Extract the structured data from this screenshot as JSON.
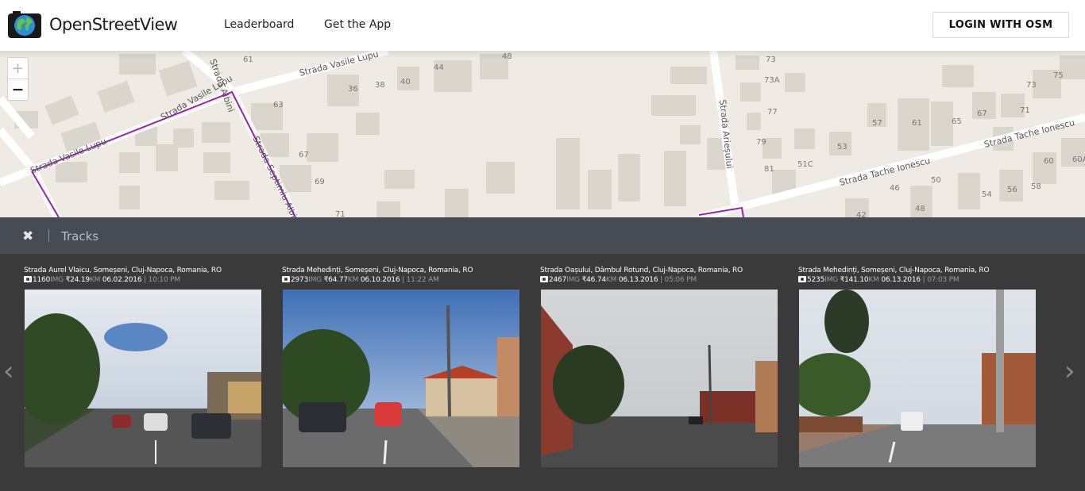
{
  "header": {
    "logo_text": "OpenStreetView",
    "nav": [
      "Leaderboard",
      "Get the App"
    ],
    "login_label": "LOGIN WITH OSM"
  },
  "map": {
    "zoom_in": "+",
    "zoom_out": "−",
    "street_labels": [
      "Strada Vasile Lupu",
      "Strada Vasile Lupu",
      "Strada Albini",
      "Strada Septimiu Albini",
      "Strada Arieșului",
      "Strada Tache Ionescu",
      "Strada Tache Ionescu"
    ],
    "house_numbers": [
      "61",
      "48",
      "44",
      "40",
      "38",
      "36",
      "63",
      "67",
      "69",
      "71",
      "73",
      "73A",
      "77",
      "79",
      "81",
      "57",
      "61",
      "65",
      "67",
      "71",
      "73",
      "75",
      "53",
      "51C",
      "50",
      "46",
      "42",
      "48",
      "54",
      "56",
      "58",
      "60",
      "60A"
    ]
  },
  "tracks": {
    "close": "✖",
    "title": "Tracks",
    "items": [
      {
        "title": "Strada Aurel Vlaicu, Someșeni, Cluj-Napoca, Romania, RO",
        "img": "1160",
        "img_unit": "IMG",
        "km": "₹24.19",
        "km_unit": "KM",
        "date": "06.02.2016",
        "time": "10:10 PM"
      },
      {
        "title": "Strada Mehedinți, Someșeni, Cluj-Napoca, Romania, RO",
        "img": "2973",
        "img_unit": "IMG",
        "km": "₹64.77",
        "km_unit": "KM",
        "date": "06.10.2016",
        "time": "11:22 AM"
      },
      {
        "title": "Strada Oașului, Dâmbul Rotund, Cluj-Napoca, Romania, RO",
        "img": "2467",
        "img_unit": "IMG",
        "km": "₹46.74",
        "km_unit": "KM",
        "date": "06.13.2016",
        "time": "05:06 PM"
      },
      {
        "title": "Strada Mehedinți, Someșeni, Cluj-Napoca, Romania, RO",
        "img": "5235",
        "img_unit": "IMG",
        "km": "₹141.10",
        "km_unit": "KM",
        "date": "06.13.2016",
        "time": "07:03 PM"
      }
    ],
    "prev_arrow": "‹",
    "next_arrow": "›"
  },
  "colors": {
    "track_line": "#9b1fb5",
    "map_bg": "#efebe4",
    "building": "#dad5cd",
    "panel": "#3a3a3a"
  }
}
